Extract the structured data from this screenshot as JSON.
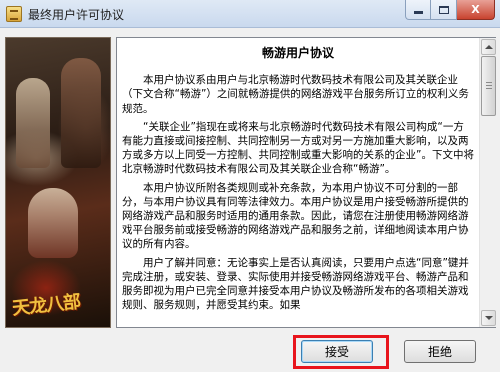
{
  "window": {
    "title": "最终用户许可协议",
    "controls": {
      "minimize": "",
      "maximize": "",
      "close": "X"
    }
  },
  "artwork": {
    "logo_text": "天龙八部",
    "icon": "game-artwork-image"
  },
  "agreement": {
    "heading": "畅游用户协议",
    "paragraphs": [
      "本用户协议系由用户与北京畅游时代数码技术有限公司及其关联企业（下文合称“畅游”）之间就畅游提供的网络游戏平台服务所订立的权利义务规范。",
      "“关联企业”指现在或将来与北京畅游时代数码技术有限公司构成“一方有能力直接或间接控制、共同控制另一方或对另一方施加重大影响，以及两方或多方以上同受一方控制、共同控制或重大影响的关系的企业”。下文中将北京畅游时代数码技术有限公司及其关联企业合称“畅游”。",
      "本用户协议所附各类规则或补充条款，为本用户协议不可分割的一部分，与本用户协议具有同等法律效力。本用户协议是用户接受畅游所提供的网络游戏产品和服务时适用的通用条款。因此，请您在注册使用畅游网络游戏平台服务前或接受畅游的网络游戏产品和服务之前，详细地阅读本用户协议的所有内容。",
      "用户了解并同意：无论事实上是否认真阅读，只要用户点选“同意”键并完成注册，或安装、登录、实际使用并接受畅游网络游戏平台、畅游产品和服务即视为用户已完全同意并接受本用户协议及畅游所发布的各项相关游戏规则、服务规则，并愿受其约束。如果"
    ]
  },
  "buttons": {
    "accept": "接受",
    "reject": "拒绝"
  },
  "colors": {
    "highlight": "#e8141c",
    "titlebar": "#c9d9ee",
    "logo": "#f0c040"
  }
}
